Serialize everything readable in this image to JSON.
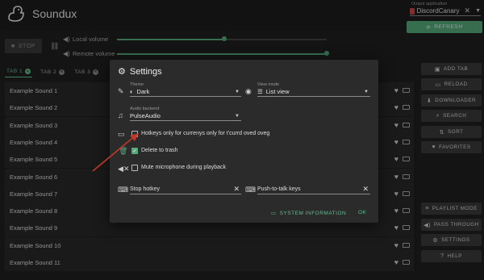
{
  "header": {
    "app_title": "Soundux",
    "output_label": "Output application",
    "output_value": "DiscordCanary",
    "refresh_label": "REFRESH"
  },
  "controls": {
    "stop_label": "STOP",
    "local_volume_label": "Local volume",
    "remote_volume_label": "Remote volume",
    "local_volume_level": 0.51,
    "remote_volume_level": 1.0
  },
  "tabs": [
    {
      "label": "TAB 1",
      "active": true
    },
    {
      "label": "TAB 2",
      "active": false
    },
    {
      "label": "TAB 3",
      "active": false
    }
  ],
  "sounds": [
    "Example Sound 1",
    "Example Sound 2",
    "Example Sound 3",
    "Example Sound 4",
    "Example Sound 5",
    "Example Sound 6",
    "Example Sound 7",
    "Example Sound 8",
    "Example Sound 9",
    "Example Sound 10",
    "Example Sound 11"
  ],
  "sidebar": {
    "add_tab": "ADD TAB",
    "reload": "RELOAD",
    "downloader": "DOWNLOADER",
    "search": "SEARCH",
    "sort": "SORT",
    "favorites": "FAVORITES",
    "playlist_mode": "PLAYLIST MODE",
    "pass_through": "PASS THROUGH",
    "settings": "SETTINGS",
    "help": "HELP"
  },
  "settings": {
    "title": "Settings",
    "theme_label": "Theme",
    "theme_value": "Dark",
    "view_mode_label": "View mode",
    "view_mode_value": "List view",
    "audio_backend_label": "Audio backend",
    "audio_backend_value": "PulseAudio",
    "hotkeys_label": "Hotkeys only for currenys only for t'currd oved oveg",
    "delete_to_trash_label": "Delete to trash",
    "delete_to_trash_checked": true,
    "mute_mic_label": "Mute microphone during playback",
    "stop_hotkey_placeholder": "Stop hotkey",
    "ptt_keys_placeholder": "Push-to-talk keys",
    "system_info_label": "SYSTEM INFORMATION",
    "ok_label": "OK"
  },
  "colors": {
    "accent": "#55a97c",
    "annotation_arrow": "#c0392b"
  }
}
